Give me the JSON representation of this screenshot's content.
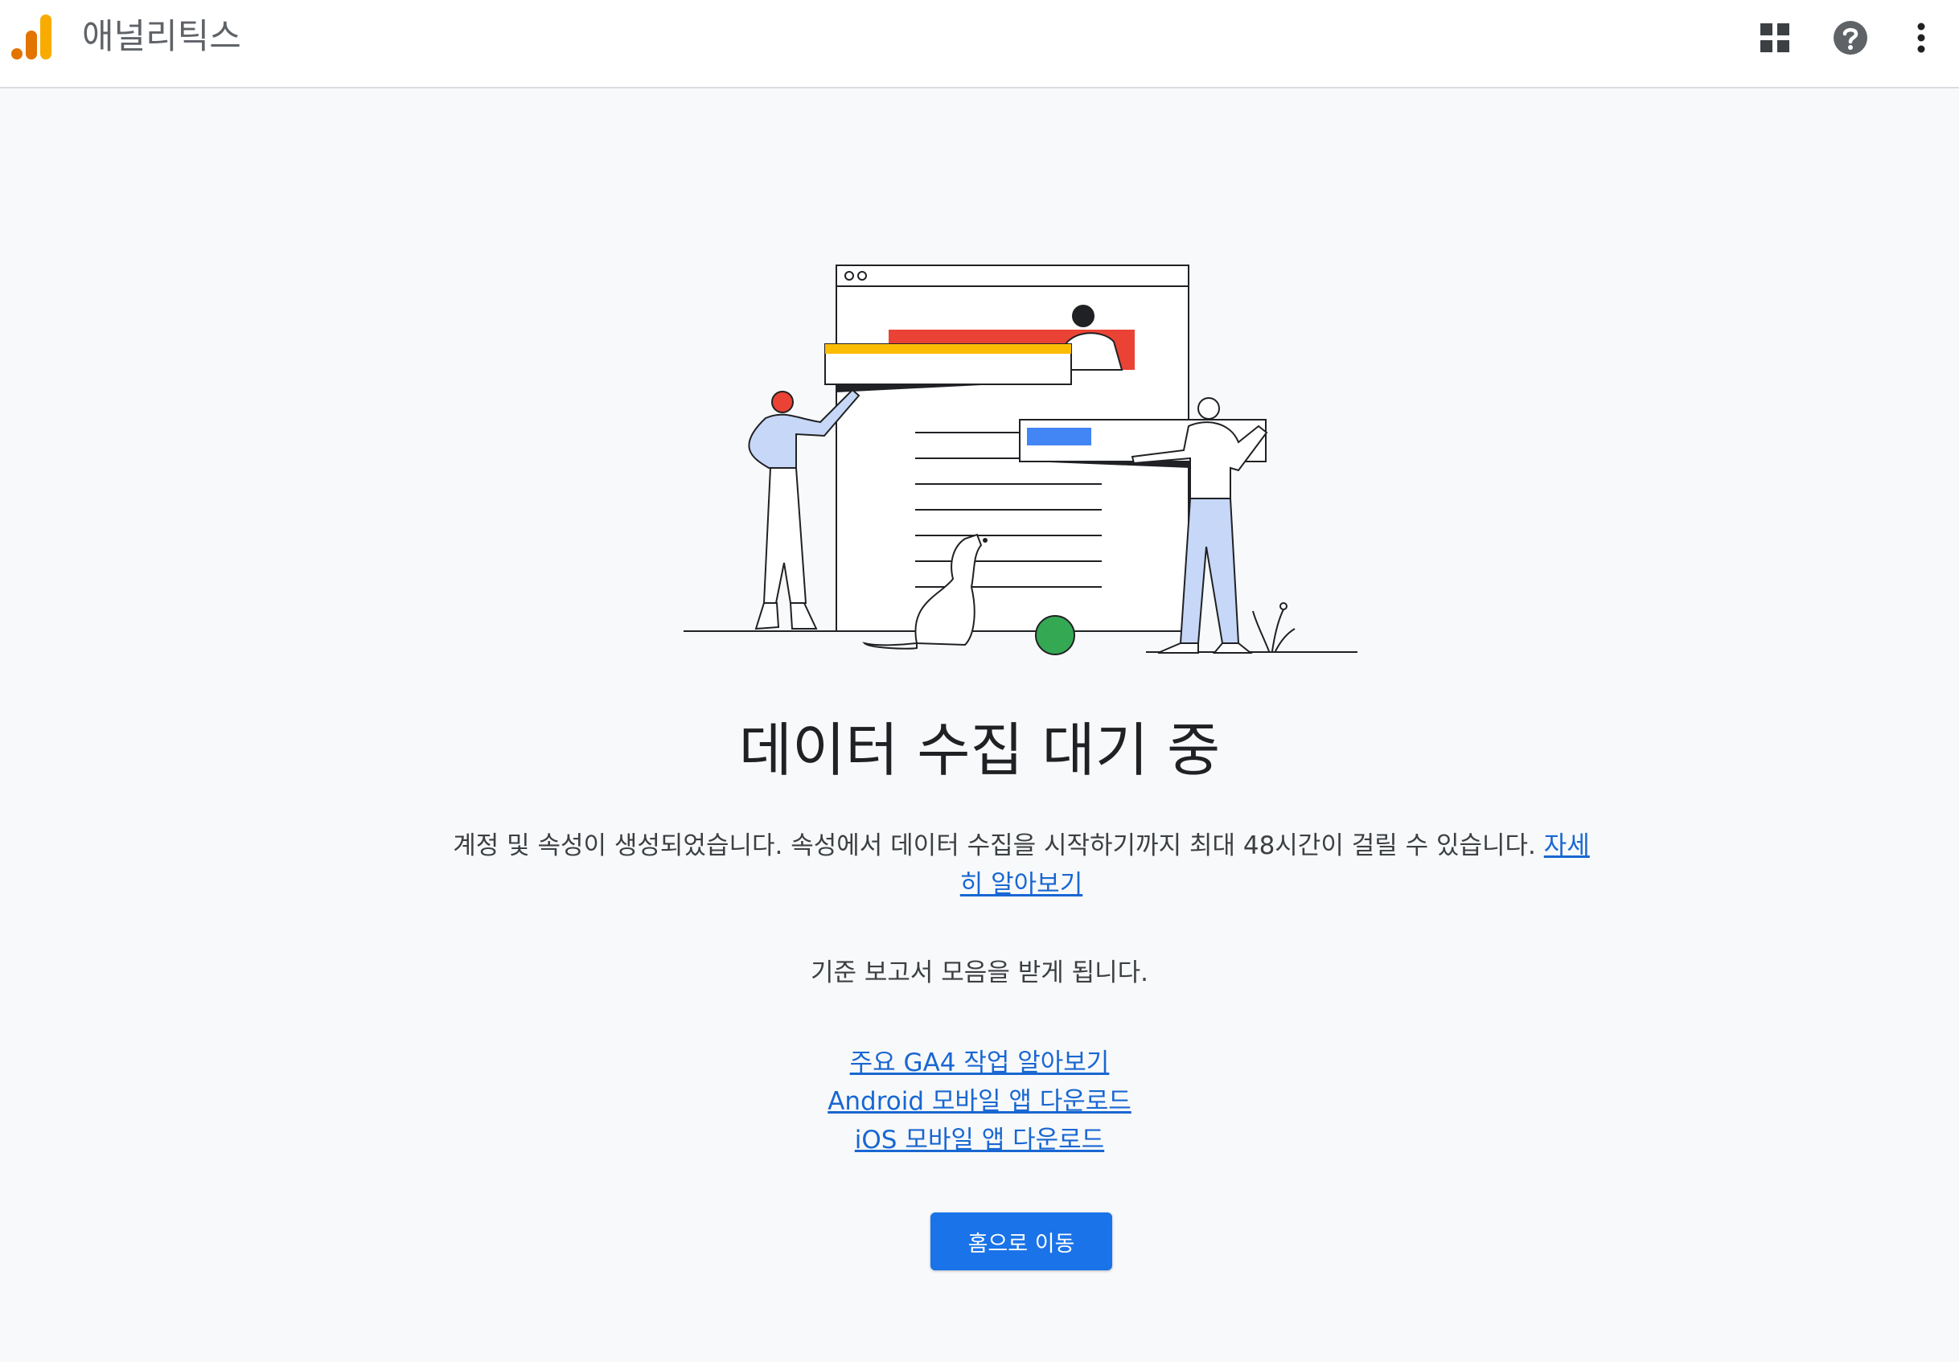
{
  "header": {
    "app_title": "애널리틱스",
    "icons": [
      "analytics-logo",
      "apps-grid-icon",
      "help-icon",
      "more-vert-icon"
    ]
  },
  "main": {
    "heading": "데이터 수집 대기 중",
    "description": "계정 및 속성이 생성되었습니다. 속성에서 데이터 수집을 시작하기까지 최대 48시간이 걸릴 수 있습니다.",
    "learn_more_link": "자세히 알아보기",
    "subtext": "기준 보고서 모음을 받게 됩니다.",
    "links": [
      "주요 GA4 작업 알아보기",
      "Android 모바일 앱 다운로드",
      "iOS 모바일 앱 다운로드"
    ],
    "home_button": "홈으로 이동"
  },
  "colors": {
    "accent_blue": "#1a73e8",
    "link_blue": "#1967d2",
    "logo_orange": "#e37400",
    "logo_yellow": "#f9ab00",
    "illustration_red": "#ea4335",
    "illustration_yellow": "#fbbc04",
    "illustration_green": "#34a853",
    "illustration_light_blue": "#c6d7f7"
  }
}
